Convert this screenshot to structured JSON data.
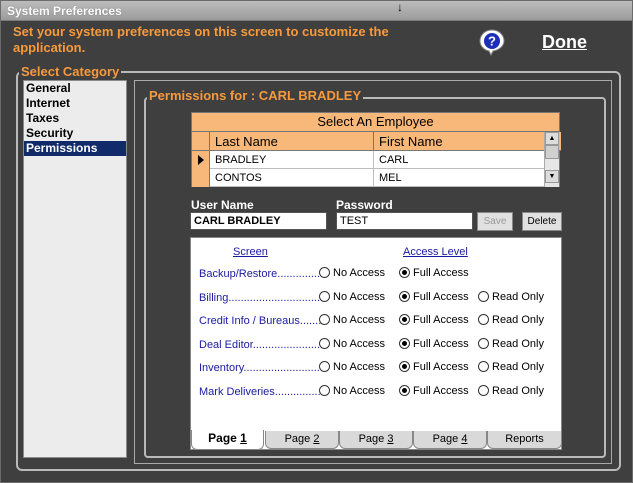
{
  "window": {
    "title": "System Preferences"
  },
  "intro": "Set your system preferences on this screen to customize the application.",
  "header": {
    "done_label": "Done",
    "help_icon": "help-question-icon"
  },
  "categories": {
    "legend": "Select Category",
    "items": [
      "General",
      "Internet",
      "Taxes",
      "Security",
      "Permissions"
    ],
    "selected": "Permissions"
  },
  "permissions": {
    "legend": "Permissions for : CARL BRADLEY",
    "grid": {
      "caption": "Select An Employee",
      "columns": [
        "Last Name",
        "First Name"
      ],
      "rows": [
        {
          "last": "BRADLEY",
          "first": "CARL"
        },
        {
          "last": "CONTOS",
          "first": "MEL"
        }
      ]
    },
    "user_name_label": "User Name",
    "user_name_value": "CARL BRADLEY",
    "password_label": "Password",
    "password_value": "TEST",
    "save_label": "Save",
    "delete_label": "Delete",
    "access": {
      "screen_header": "Screen",
      "level_header": "Access Level",
      "option_labels": {
        "none": "No Access",
        "full": "Full Access",
        "read": "Read Only"
      },
      "rows": [
        {
          "screen": "Backup/Restore..............",
          "selected": "full",
          "has_read": false
        },
        {
          "screen": "Billing...............................",
          "selected": "full",
          "has_read": true
        },
        {
          "screen": "Credit Info / Bureaus.......",
          "selected": "full",
          "has_read": true
        },
        {
          "screen": "Deal Editor........................",
          "selected": "full",
          "has_read": true
        },
        {
          "screen": "Inventory.........................",
          "selected": "full",
          "has_read": true
        },
        {
          "screen": "Mark Deliveries...............",
          "selected": "full",
          "has_read": true
        }
      ]
    },
    "tabs": [
      {
        "prefix": "Page ",
        "num": "1",
        "active": true
      },
      {
        "prefix": "Page ",
        "num": "2",
        "active": false
      },
      {
        "prefix": "Page ",
        "num": "3",
        "active": false
      },
      {
        "prefix": "Page ",
        "num": "4",
        "active": false
      },
      {
        "prefix": "Reports",
        "num": "",
        "active": false
      }
    ]
  },
  "colors": {
    "accent": "#f79a3b",
    "grid_header": "#f7b879",
    "selection": "#102a6a",
    "link_text": "#1a1aa0"
  }
}
